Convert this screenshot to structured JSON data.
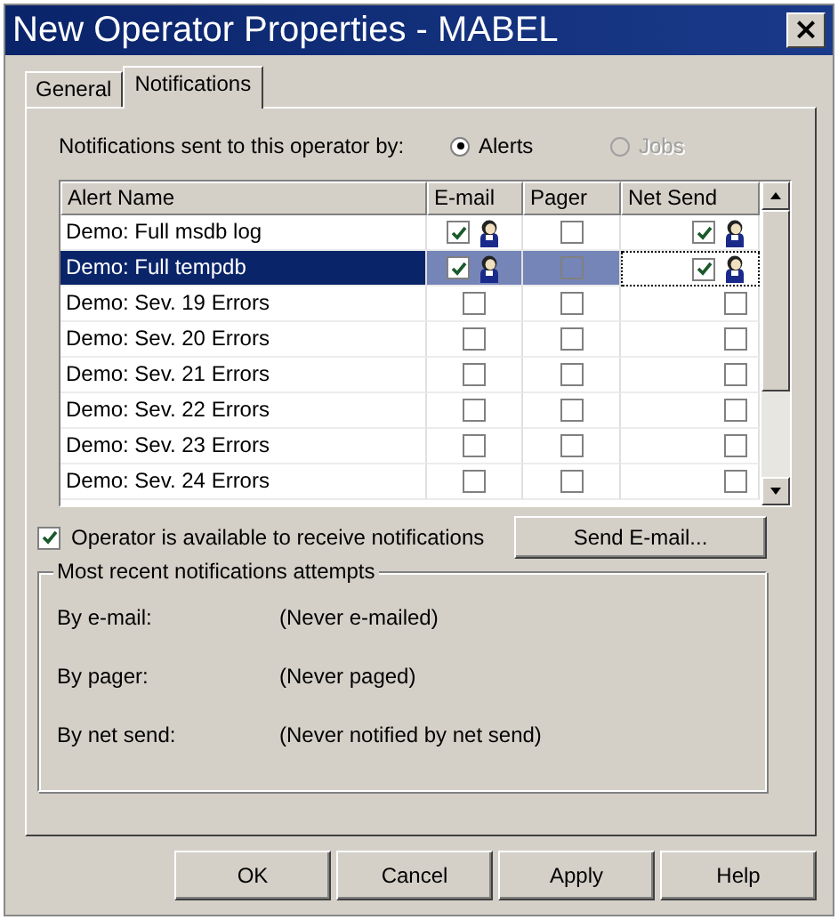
{
  "window": {
    "title": "New Operator Properties - MABEL",
    "close": "×"
  },
  "tabs": [
    {
      "label": "General",
      "selected": false
    },
    {
      "label": "Notifications",
      "selected": true
    }
  ],
  "notify_by": {
    "label": "Notifications sent to this operator by:",
    "options": [
      {
        "label": "Alerts",
        "selected": true,
        "disabled": false
      },
      {
        "label": "Jobs",
        "selected": false,
        "disabled": true
      }
    ]
  },
  "table": {
    "columns": [
      "Alert Name",
      "E-mail",
      "Pager",
      "Net Send"
    ],
    "rows": [
      {
        "name": "Demo: Full msdb log",
        "email": true,
        "pager": false,
        "net_send": true,
        "selected": false
      },
      {
        "name": "Demo: Full tempdb",
        "email": true,
        "pager": false,
        "net_send": true,
        "selected": true
      },
      {
        "name": "Demo: Sev. 19 Errors",
        "email": false,
        "pager": false,
        "net_send": false,
        "selected": false
      },
      {
        "name": "Demo: Sev. 20 Errors",
        "email": false,
        "pager": false,
        "net_send": false,
        "selected": false
      },
      {
        "name": "Demo: Sev. 21 Errors",
        "email": false,
        "pager": false,
        "net_send": false,
        "selected": false
      },
      {
        "name": "Demo: Sev. 22 Errors",
        "email": false,
        "pager": false,
        "net_send": false,
        "selected": false
      },
      {
        "name": "Demo: Sev. 23 Errors",
        "email": false,
        "pager": false,
        "net_send": false,
        "selected": false
      },
      {
        "name": "Demo: Sev. 24 Errors",
        "email": false,
        "pager": false,
        "net_send": false,
        "selected": false
      }
    ]
  },
  "available": {
    "label": "Operator is available to receive notifications",
    "checked": true
  },
  "send_email_button": "Send E-mail...",
  "recent": {
    "title": "Most recent notifications attempts",
    "items": [
      {
        "label": "By e-mail:",
        "value": "(Never e-mailed)"
      },
      {
        "label": "By pager:",
        "value": "(Never paged)"
      },
      {
        "label": "By net send:",
        "value": "(Never notified by net send)"
      }
    ]
  },
  "buttons": [
    "OK",
    "Cancel",
    "Apply",
    "Help"
  ]
}
